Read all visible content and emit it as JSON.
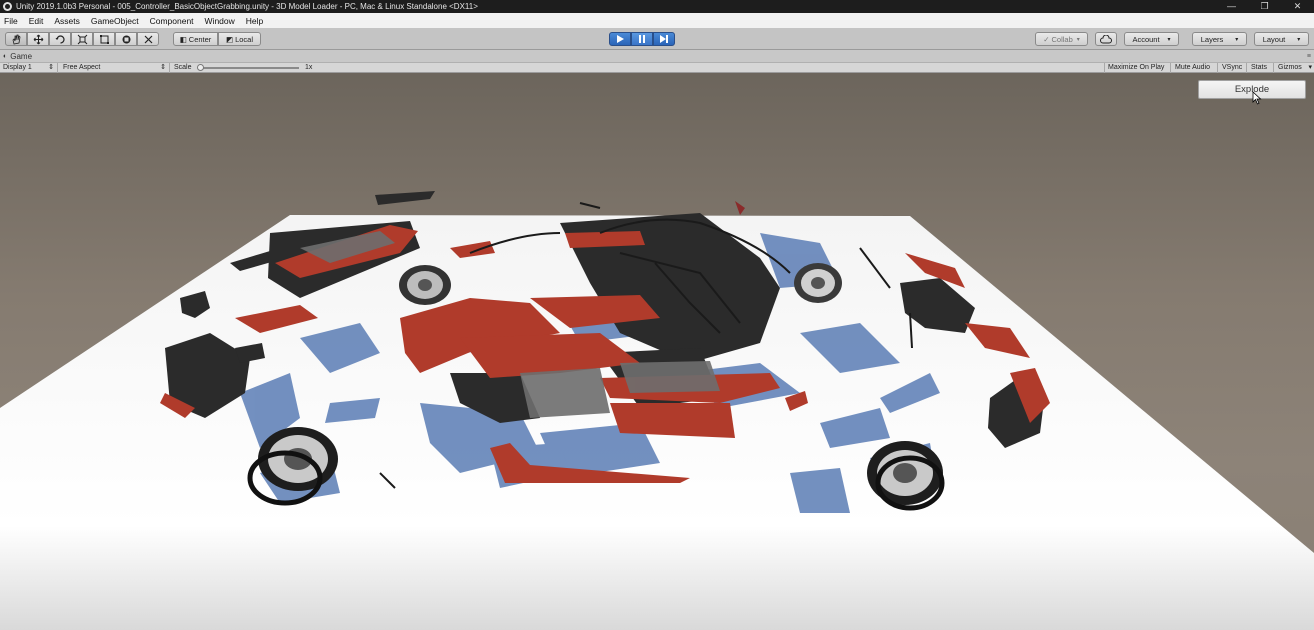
{
  "window": {
    "title": "Unity 2019.1.0b3 Personal - 005_Controller_BasicObjectGrabbing.unity - 3D Model Loader - PC, Mac & Linux Standalone <DX11>",
    "controls": {
      "minimize": "—",
      "restore": "❐",
      "close": "✕"
    }
  },
  "menu": [
    "File",
    "Edit",
    "Assets",
    "GameObject",
    "Component",
    "Window",
    "Help"
  ],
  "toolbar": {
    "pivot": "Center",
    "space": "Local",
    "collab": "Collab",
    "account": "Account",
    "layers": "Layers",
    "layout": "Layout"
  },
  "game_tab": {
    "label": "Game"
  },
  "game_bar": {
    "display": "Display 1",
    "aspect": "Free Aspect",
    "scale_label": "Scale",
    "scale_value": "1x",
    "maximize": "Maximize On Play",
    "mute": "Mute Audio",
    "vsync": "VSync",
    "stats": "Stats",
    "gizmos": "Gizmos"
  },
  "scene": {
    "button_label": "Explode",
    "colors": {
      "car_body": "#b03b2b",
      "floor": "#f7f7f7",
      "shadow": "#5c7fb8",
      "background": "#766e64"
    }
  }
}
